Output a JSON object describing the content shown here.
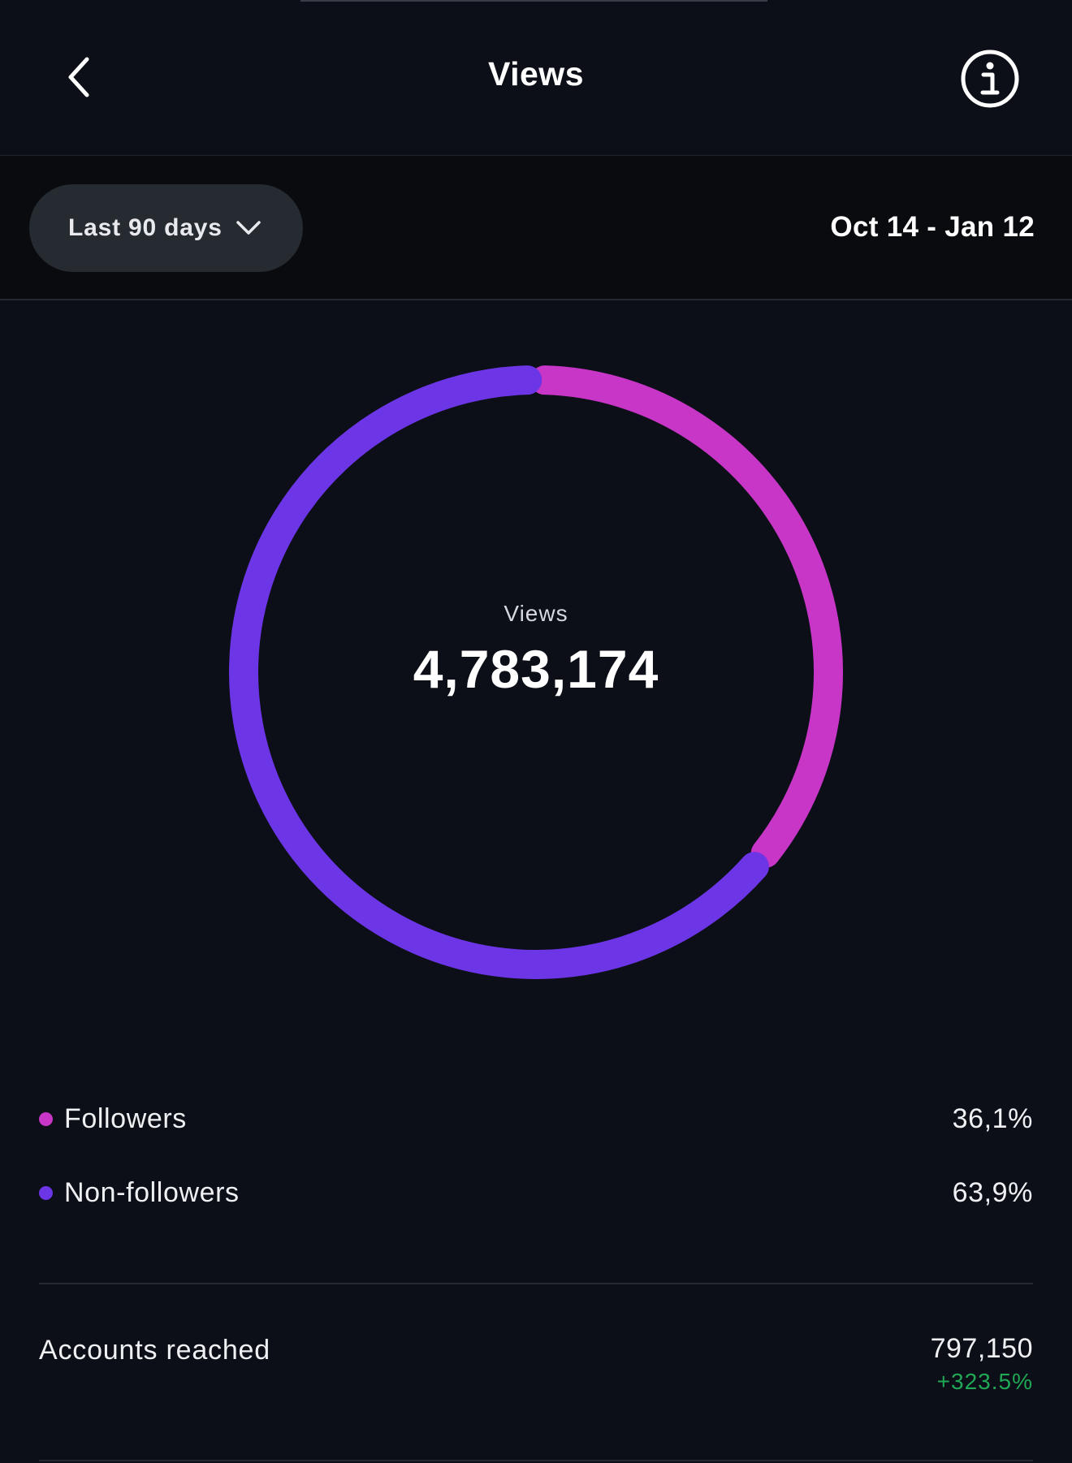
{
  "header": {
    "title": "Views",
    "back_icon": "chevron-left-icon",
    "info_icon": "info-icon"
  },
  "filter": {
    "range_label": "Last 90 days",
    "range_icon": "chevron-down-icon",
    "date_range": "Oct 14 - Jan 12"
  },
  "summary": {
    "label": "Views",
    "total": "4,783,174"
  },
  "colors": {
    "background": "#0c0f17",
    "followers": "#c836c8",
    "non_followers": "#6c35e6",
    "positive": "#1fa855"
  },
  "legend": [
    {
      "label": "Followers",
      "value": "36,1%"
    },
    {
      "label": "Non-followers",
      "value": "63,9%"
    }
  ],
  "chart_data": {
    "type": "pie",
    "categories": [
      "Followers",
      "Non-followers"
    ],
    "values": [
      36.1,
      63.9
    ]
  },
  "metrics": [
    {
      "label": "Accounts reached",
      "value": "797,150",
      "change": "+323.5%"
    }
  ]
}
